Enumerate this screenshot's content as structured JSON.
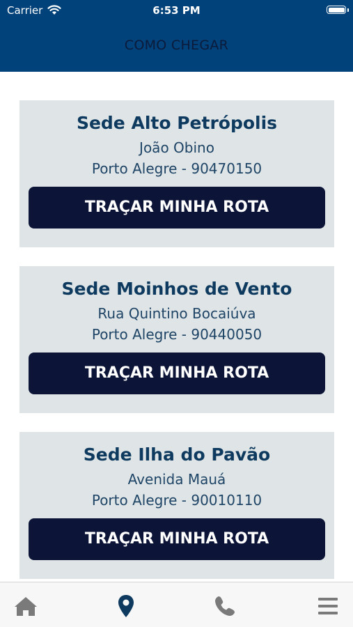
{
  "status_bar": {
    "carrier": "Carrier",
    "time": "6:53 PM"
  },
  "header": {
    "title": "COMO CHEGAR"
  },
  "locations": [
    {
      "name": "Sede Alto Petrópolis",
      "address": "João Obino",
      "city_zip": "Porto Alegre - 90470150",
      "button_label": "TRAÇAR MINHA ROTA"
    },
    {
      "name": "Sede Moinhos de Vento",
      "address": "Rua Quintino Bocaiúva",
      "city_zip": "Porto Alegre - 90440050",
      "button_label": "TRAÇAR MINHA ROTA"
    },
    {
      "name": "Sede Ilha do Pavão",
      "address": "Avenida Mauá",
      "city_zip": "Porto Alegre - 90010110",
      "button_label": "TRAÇAR MINHA ROTA"
    }
  ],
  "tabbar": {
    "items": [
      {
        "icon": "home-icon",
        "active": false
      },
      {
        "icon": "map-pin-icon",
        "active": true
      },
      {
        "icon": "phone-icon",
        "active": false
      },
      {
        "icon": "menu-icon",
        "active": false
      }
    ]
  },
  "colors": {
    "header_bg": "#02427a",
    "card_bg": "#dfe4e6",
    "button_bg": "#0c1438",
    "active_tab": "#0d3a5e",
    "inactive_tab": "#7a7a7a"
  }
}
